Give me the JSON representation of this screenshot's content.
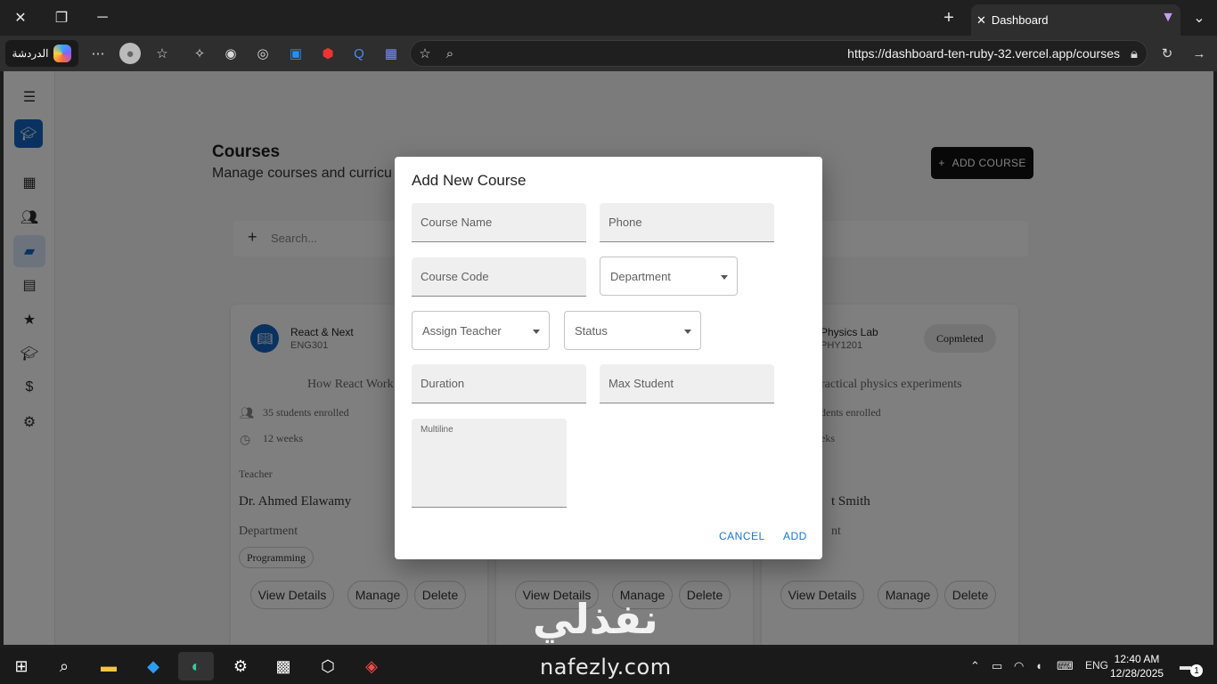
{
  "browser": {
    "tab_title": "Dashboard",
    "chat_label": "الدردشة",
    "url": "https://dashboard-ten-ruby-32.vercel.app/courses"
  },
  "page": {
    "title": "Courses",
    "subtitle": "Manage courses and curricu",
    "add_course_label": "ADD COURSE",
    "search_placeholder": "Search...",
    "sidebar_icons": [
      "menu-icon",
      "dashboard-icon",
      "people-icon",
      "courses-icon",
      "calendar-icon",
      "star-icon",
      "graduation-icon",
      "dollar-icon",
      "settings-icon"
    ]
  },
  "cards": [
    {
      "name": "React & Next",
      "code": "ENG301",
      "description": "How React Work",
      "students": "35 students enrolled",
      "duration": "12 weeks",
      "teacher_label": "Teacher",
      "teacher": "Dr. Ahmed Elawamy",
      "department_label": "Department",
      "department": "Programming",
      "view_label": "View Details",
      "manage_label": "Manage",
      "delete_label": "Delete"
    },
    {
      "view_label": "View Details",
      "manage_label": "Manage",
      "delete_label": "Delete"
    },
    {
      "name": "Physics Lab",
      "code": "PHY1201",
      "status": "Copmleted",
      "description": "ractical physics experiments",
      "students": "dents enrolled",
      "duration": "eks",
      "teacher": "t Smith",
      "department": "nt",
      "view_label": "View Details",
      "manage_label": "Manage",
      "delete_label": "Delete"
    }
  ],
  "dialog": {
    "title": "Add New Course",
    "course_name_placeholder": "Course Name",
    "phone_placeholder": "Phone",
    "course_code_placeholder": "Course Code",
    "department_label": "Department",
    "assign_teacher_label": "Assign Teacher",
    "status_label": "Status",
    "duration_placeholder": "Duration",
    "max_student_placeholder": "Max Student",
    "multiline_label": "Multiline",
    "cancel_label": "CANCEL",
    "add_label": "ADD"
  },
  "watermark": {
    "arabic": "نفذلي",
    "latin": "nafezly.com"
  },
  "taskbar": {
    "language": "ENG",
    "time": "12:40 AM",
    "date": "12/28/2025",
    "notification_count": "1"
  },
  "colors": {
    "accent": "#1976d2",
    "sidebar_active": "#1565c0",
    "add_course_bg": "#111111"
  }
}
